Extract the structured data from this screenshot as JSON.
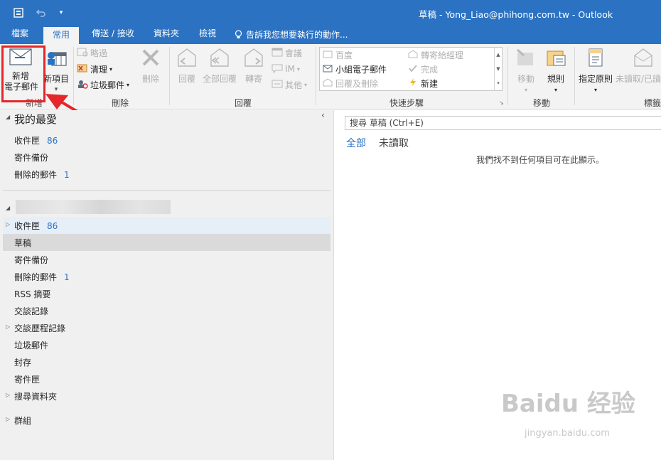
{
  "window": {
    "title": "草稿 - Yong_Liao@phihong.com.tw - Outlook"
  },
  "tabs": [
    {
      "label": "檔案"
    },
    {
      "label": "常用"
    },
    {
      "label": "傳送 / 接收"
    },
    {
      "label": "資料夾"
    },
    {
      "label": "檢視"
    },
    {
      "label": "告訴我您想要執行的動作..."
    }
  ],
  "ribbon": {
    "new_group": {
      "new_mail_line1": "新增",
      "new_mail_line2": "電子郵件",
      "new_items": "新項目",
      "label": "新增"
    },
    "delete_group": {
      "ignore": "略過",
      "cleanup": "清理",
      "junk": "垃圾郵件",
      "delete": "刪除",
      "label": "刪除"
    },
    "respond_group": {
      "reply": "回覆",
      "reply_all": "全部回覆",
      "forward": "轉寄",
      "meeting": "會議",
      "im": "IM",
      "more": "其他",
      "label": "回覆"
    },
    "quicksteps_group": {
      "items": [
        "百度",
        "轉寄給經理",
        "小組電子郵件",
        "完成",
        "回覆及刪除",
        "新建"
      ],
      "label": "快速步驟"
    },
    "move_group": {
      "move": "移動",
      "rules": "規則",
      "label": "移動"
    },
    "tags_group": {
      "assign_policy": "指定原則",
      "unread_read": "未讀取/已讀",
      "label": "標籤"
    }
  },
  "nav": {
    "favorites": {
      "header": "我的最愛",
      "items": [
        {
          "label": "收件匣",
          "count": "86"
        },
        {
          "label": "寄件備份",
          "count": ""
        },
        {
          "label": "刪除的郵件",
          "count": "1"
        }
      ]
    },
    "account": {
      "items": [
        {
          "label": "收件匣",
          "count": "86"
        },
        {
          "label": "草稿",
          "count": ""
        },
        {
          "label": "寄件備份",
          "count": ""
        },
        {
          "label": "刪除的郵件",
          "count": "1"
        },
        {
          "label": "RSS 摘要",
          "count": ""
        },
        {
          "label": "交談記錄",
          "count": ""
        },
        {
          "label": "交談歷程記錄",
          "count": ""
        },
        {
          "label": "垃圾郵件",
          "count": ""
        },
        {
          "label": "封存",
          "count": ""
        },
        {
          "label": "寄件匣",
          "count": ""
        },
        {
          "label": "搜尋資料夾",
          "count": ""
        }
      ]
    },
    "groups": {
      "label": "群組"
    }
  },
  "main": {
    "search_placeholder": "搜尋 草稿 (Ctrl+E)",
    "filters": {
      "all": "全部",
      "unread": "未讀取"
    },
    "empty_message": "我們找不到任何項目可在此顯示。"
  },
  "watermark": {
    "brand": "Baidu 经验",
    "url": "jingyan.baidu.com"
  },
  "colors": {
    "accent": "#2b72c2",
    "highlight": "#e5262a"
  }
}
